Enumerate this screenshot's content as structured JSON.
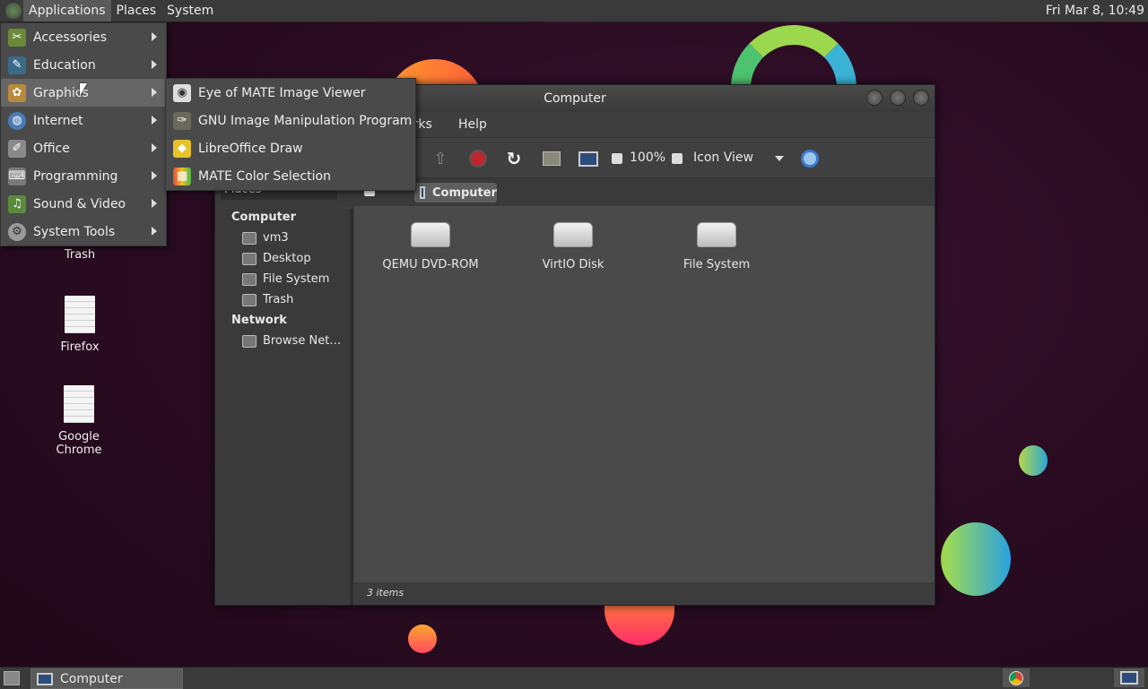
{
  "top_panel": {
    "menus": [
      "Applications",
      "Places",
      "System"
    ],
    "clock": "Fri Mar  8, 10:49"
  },
  "app_menu": {
    "items": [
      {
        "label": "Accessories",
        "icon": "accessories-icon"
      },
      {
        "label": "Education",
        "icon": "education-icon"
      },
      {
        "label": "Graphics",
        "icon": "graphics-icon"
      },
      {
        "label": "Internet",
        "icon": "internet-icon"
      },
      {
        "label": "Office",
        "icon": "office-icon"
      },
      {
        "label": "Programming",
        "icon": "programming-icon"
      },
      {
        "label": "Sound & Video",
        "icon": "sound-video-icon"
      },
      {
        "label": "System Tools",
        "icon": "system-tools-icon"
      }
    ]
  },
  "graphics_submenu": {
    "items": [
      {
        "label": "Eye of MATE Image Viewer",
        "icon": "image-viewer-icon"
      },
      {
        "label": "GNU Image Manipulation Program",
        "icon": "gimp-icon"
      },
      {
        "label": "LibreOffice Draw",
        "icon": "libreoffice-draw-icon"
      },
      {
        "label": "MATE Color Selection",
        "icon": "color-selection-icon"
      }
    ]
  },
  "desktop_icons": [
    "Trash",
    "Firefox",
    "Google Chrome"
  ],
  "window": {
    "title": "Computer",
    "menubar": [
      "arks",
      "Help"
    ],
    "toolbar": {
      "zoom": "100%",
      "view": "Icon View"
    },
    "location": "Computer",
    "side_pane": {
      "selector": "Places",
      "sections": [
        {
          "heading": "Computer",
          "items": [
            "vm3",
            "Desktop",
            "File System",
            "Trash"
          ]
        },
        {
          "heading": "Network",
          "items": [
            "Browse Net…"
          ]
        }
      ]
    },
    "drives": [
      "QEMU DVD-ROM",
      "VirtIO Disk",
      "File System"
    ],
    "status": "3 items"
  },
  "taskbar": {
    "task": "Computer"
  },
  "colors": {
    "panel": "#3a3a3a",
    "menu": "#4a4a4a",
    "menu_active": "#666666",
    "desktop": "#2a0d1f"
  }
}
